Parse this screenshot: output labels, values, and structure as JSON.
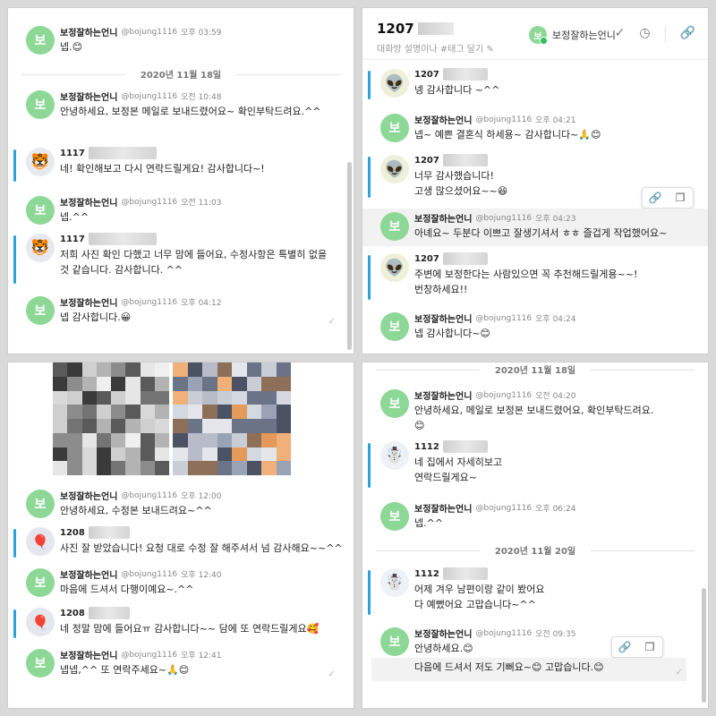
{
  "brand": {
    "avatar_char": "보",
    "name": "보정잘하는언니",
    "handle": "@bojung1116",
    "color": "#8ed897"
  },
  "accent": "#2aa1de",
  "panel1": {
    "messages": [
      {
        "kind": "mine",
        "time": "오후 03:59",
        "text": "넵.😊",
        "show_meta": true
      },
      {
        "kind": "date",
        "text": "2020년 11월 18일"
      },
      {
        "kind": "mine",
        "time": "오전 10:48",
        "text": "안녕하세요, 보정본 메일로 보내드렸어요~ 확인부탁드려요.^^"
      },
      {
        "kind": "other",
        "name": "1117",
        "avatar": "🐯",
        "text": "네! 확인해보고 다시 연락드릴게요! 감사합니다~!"
      },
      {
        "kind": "mine",
        "time": "오전 11:03",
        "text": "넵.^^"
      },
      {
        "kind": "other",
        "name": "1117",
        "avatar": "🐯",
        "text": "저희 사진 확인 다했고 너무 맘에 들어요, 수정사항은 특별히 없을 것 같습니다. 감사합니다. ^^"
      },
      {
        "kind": "mine",
        "time": "오후 04:12",
        "text": "넵 감사합니다.😀"
      }
    ]
  },
  "panel2": {
    "header": {
      "title": "1207",
      "subtitle": "대화방 설명이나 #태그 달기",
      "user": "보정잘하는언니",
      "icons": [
        "check-icon",
        "clock-icon",
        "link-icon"
      ]
    },
    "messages": [
      {
        "kind": "other",
        "name": "1207",
        "avatar": "👽",
        "text": "넹 감사합니다 ~^^"
      },
      {
        "kind": "mine",
        "time": "오후 04:21",
        "text": "넵~ 예쁜 결혼식 하세용~ 감사합니다~🙏😊"
      },
      {
        "kind": "other",
        "name": "1207",
        "avatar": "👽",
        "text": "너무 감사했습니다!\n고생 많으셨어요~~😆"
      },
      {
        "kind": "mine",
        "time": "오후 04:23",
        "text": "아녜요~ 두분다 이쁘고 잘생기셔서 ㅎㅎ 즐겁게 작업했어요~"
      },
      {
        "kind": "other",
        "name": "1207",
        "avatar": "👽",
        "text": "주변에 보정한다는 사람있으면 꼭 추천해드릴게용~~!\n번창하세요!!"
      },
      {
        "kind": "mine",
        "time": "오후 04:24",
        "text": "넵 감사합니다~😊"
      }
    ]
  },
  "panel3": {
    "messages": [
      {
        "kind": "mine",
        "time": "오후 12:00",
        "text": "안녕하세요, 수정본 보내드려요~^^"
      },
      {
        "kind": "other",
        "name": "1208",
        "avatar": "🎈",
        "text": "사진 잘 받았습니다! 요청 대로 수정 잘 해주셔서 넘 감사해요~~^^"
      },
      {
        "kind": "mine",
        "time": "오후 12:40",
        "text": "마음에 드셔서 다행이예요~.^^"
      },
      {
        "kind": "other",
        "name": "1208",
        "avatar": "🎈",
        "text": "네 정말 맘에 들어요ㅠ 감사합니다~~ 담에 또 연락드릴게요🥰"
      },
      {
        "kind": "mine",
        "time": "오후 12:41",
        "text": "넵넵,^^ 또 연락주세요~🙏😊"
      }
    ]
  },
  "panel4": {
    "messages": [
      {
        "kind": "date",
        "text": "2020년 11월 18일"
      },
      {
        "kind": "mine",
        "time": "오전 04:20",
        "text": "안녕하세요, 메일로 보정본 보내드렸어요, 확인부탁드려요.\n😊"
      },
      {
        "kind": "other",
        "name": "1112",
        "avatar": "☃️",
        "text": "네 집에서 자세히보고\n연락드릴게요~"
      },
      {
        "kind": "mine",
        "time": "오후 06:24",
        "text": "넵.^^"
      },
      {
        "kind": "date",
        "text": "2020년 11월 20일"
      },
      {
        "kind": "other",
        "name": "1112",
        "avatar": "☃️",
        "text": "어제 겨우 남편이랑 같이 봤어요\n다 예뻤어요 고맙습니다~^^"
      },
      {
        "kind": "mine",
        "time": "오전 09:35",
        "text": "안녕하세요.😊"
      },
      {
        "kind": "cont",
        "text": "다음에 드셔서 저도 기뻐요~😊 고맙습니다.😊"
      }
    ]
  }
}
